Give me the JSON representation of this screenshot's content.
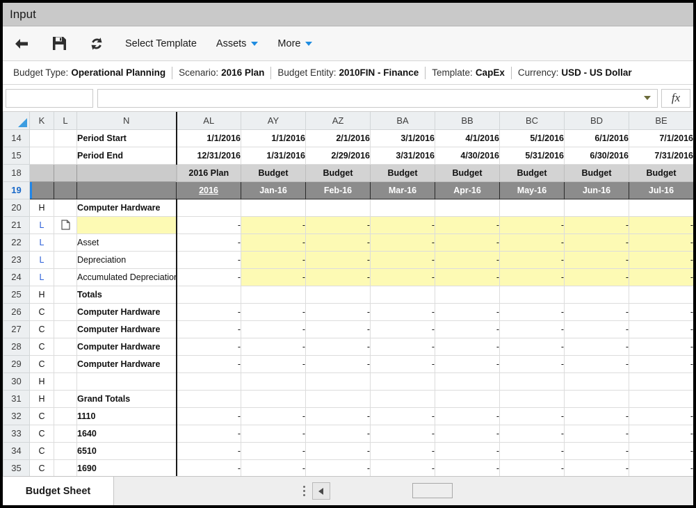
{
  "window": {
    "title": "Input"
  },
  "toolbar": {
    "back_icon": "back-arrow-icon",
    "save_icon": "save-floppy-icon",
    "refresh_icon": "refresh-sync-icon",
    "select_template": "Select Template",
    "assets": "Assets",
    "more": "More"
  },
  "infobar": {
    "budget_type_label": "Budget Type:",
    "budget_type_value": "Operational Planning",
    "scenario_label": "Scenario:",
    "scenario_value": "2016 Plan",
    "entity_label": "Budget Entity:",
    "entity_value": "2010FIN - Finance",
    "template_label": "Template:",
    "template_value": "CapEx",
    "currency_label": "Currency:",
    "currency_value": "USD - US Dollar"
  },
  "formulabar": {
    "namebox_value": "",
    "formula_value": "",
    "fx_label": "fx"
  },
  "grid": {
    "columns": [
      "",
      "K",
      "L",
      "N",
      "AL",
      "AY",
      "AZ",
      "BA",
      "BB",
      "BC",
      "BD",
      "BE"
    ],
    "rows": [
      {
        "num": "14",
        "k": "",
        "l": "",
        "n": "Period Start",
        "vals": [
          "1/1/2016",
          "1/1/2016",
          "2/1/2016",
          "3/1/2016",
          "4/1/2016",
          "5/1/2016",
          "6/1/2016",
          "7/1/2016"
        ]
      },
      {
        "num": "15",
        "k": "",
        "l": "",
        "n": "Period End",
        "vals": [
          "12/31/2016",
          "1/31/2016",
          "2/29/2016",
          "3/31/2016",
          "4/30/2016",
          "5/31/2016",
          "6/30/2016",
          "7/31/2016"
        ]
      },
      {
        "num": "18",
        "k": "",
        "l": "",
        "n": "",
        "vals": [
          "2016 Plan",
          "Budget",
          "Budget",
          "Budget",
          "Budget",
          "Budget",
          "Budget",
          "Budget"
        ]
      },
      {
        "num": "19",
        "k": "",
        "l": "",
        "n": "",
        "vals": [
          "2016",
          "Jan-16",
          "Feb-16",
          "Mar-16",
          "Apr-16",
          "May-16",
          "Jun-16",
          "Jul-16"
        ]
      },
      {
        "num": "20",
        "k": "H",
        "l": "",
        "n": "Computer Hardware",
        "vals": [
          "",
          "",
          "",
          "",
          "",
          "",
          "",
          ""
        ]
      },
      {
        "num": "21",
        "k": "L",
        "l": "note-icon",
        "n": "",
        "vals": [
          "-",
          "-",
          "-",
          "-",
          "-",
          "-",
          "-",
          "-"
        ]
      },
      {
        "num": "22",
        "k": "L",
        "l": "",
        "n": "Asset",
        "vals": [
          "-",
          "-",
          "-",
          "-",
          "-",
          "-",
          "-",
          "-"
        ]
      },
      {
        "num": "23",
        "k": "L",
        "l": "",
        "n": "Depreciation",
        "vals": [
          "-",
          "-",
          "-",
          "-",
          "-",
          "-",
          "-",
          "-"
        ]
      },
      {
        "num": "24",
        "k": "L",
        "l": "",
        "n": "Accumulated Depreciation",
        "vals": [
          "-",
          "-",
          "-",
          "-",
          "-",
          "-",
          "-",
          "-"
        ]
      },
      {
        "num": "25",
        "k": "H",
        "l": "",
        "n": "Totals",
        "vals": [
          "",
          "",
          "",
          "",
          "",
          "",
          "",
          ""
        ]
      },
      {
        "num": "26",
        "k": "C",
        "l": "",
        "n": "Computer Hardware",
        "vals": [
          "-",
          "-",
          "-",
          "-",
          "-",
          "-",
          "-",
          "-"
        ]
      },
      {
        "num": "27",
        "k": "C",
        "l": "",
        "n": "Computer Hardware",
        "vals": [
          "-",
          "-",
          "-",
          "-",
          "-",
          "-",
          "-",
          "-"
        ]
      },
      {
        "num": "28",
        "k": "C",
        "l": "",
        "n": "Computer Hardware",
        "vals": [
          "-",
          "-",
          "-",
          "-",
          "-",
          "-",
          "-",
          "-"
        ]
      },
      {
        "num": "29",
        "k": "C",
        "l": "",
        "n": "Computer Hardware",
        "vals": [
          "-",
          "-",
          "-",
          "-",
          "-",
          "-",
          "-",
          "-"
        ]
      },
      {
        "num": "30",
        "k": "H",
        "l": "",
        "n": "",
        "vals": [
          "",
          "",
          "",
          "",
          "",
          "",
          "",
          ""
        ]
      },
      {
        "num": "31",
        "k": "H",
        "l": "",
        "n": "Grand Totals",
        "vals": [
          "",
          "",
          "",
          "",
          "",
          "",
          "",
          ""
        ]
      },
      {
        "num": "32",
        "k": "C",
        "l": "",
        "n": "1110",
        "vals": [
          "-",
          "-",
          "-",
          "-",
          "-",
          "-",
          "-",
          "-"
        ]
      },
      {
        "num": "33",
        "k": "C",
        "l": "",
        "n": "1640",
        "vals": [
          "-",
          "-",
          "-",
          "-",
          "-",
          "-",
          "-",
          "-"
        ]
      },
      {
        "num": "34",
        "k": "C",
        "l": "",
        "n": "6510",
        "vals": [
          "-",
          "-",
          "-",
          "-",
          "-",
          "-",
          "-",
          "-"
        ]
      },
      {
        "num": "35",
        "k": "C",
        "l": "",
        "n": "1690",
        "vals": [
          "-",
          "-",
          "-",
          "-",
          "-",
          "-",
          "-",
          "-"
        ]
      }
    ]
  },
  "tabbar": {
    "sheet_name": "Budget Sheet"
  },
  "colors": {
    "title_bg": "#c9c9c9",
    "accent_blue": "#2186e8",
    "input_yellow": "#fdfab4",
    "band18_gray": "#d3d3d3",
    "band19_gray": "#8c8c8c",
    "caret_blue": "#1f8ce0"
  }
}
